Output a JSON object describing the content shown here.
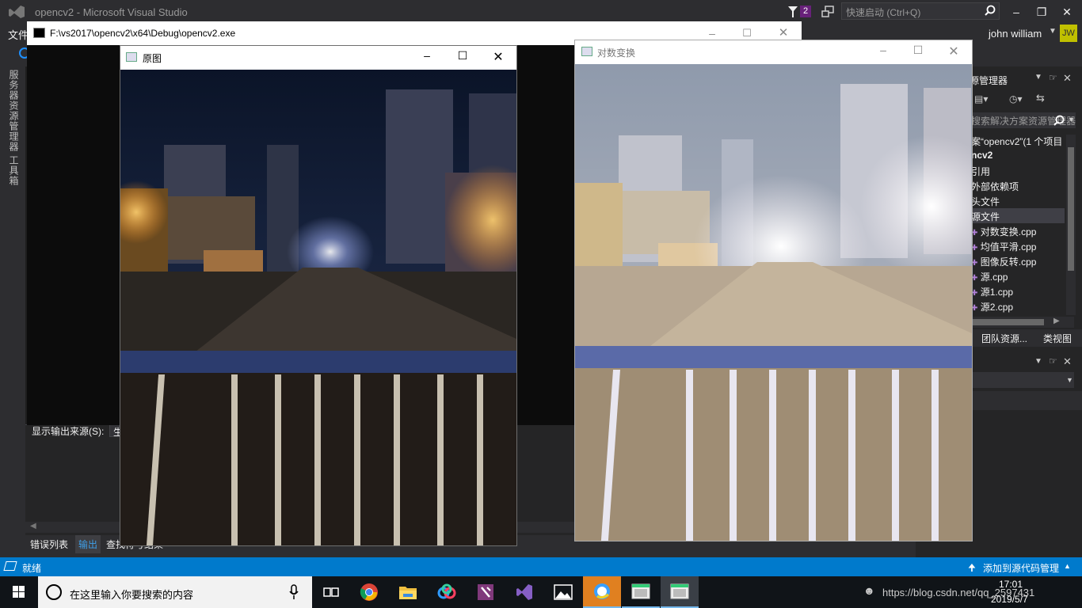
{
  "vs": {
    "title": "opencv2 - Microsoft Visual Studio",
    "notification_count": "2",
    "quick_launch_placeholder": "快速启动 (Ctrl+Q)",
    "menu_first": "文件",
    "user_name": "john william",
    "user_initials": "JW",
    "left_strip": [
      "服务器资源管理器",
      "工具箱"
    ],
    "output": {
      "source_label": "显示输出来源(S):",
      "source_value": "生"
    },
    "bottom_tabs": [
      "错误列表",
      "输出",
      "查找符号结果"
    ],
    "solution_explorer": {
      "title": "源管理器",
      "search_placeholder": "搜索解决方案资源管理器(Ctrl+",
      "items": [
        "案“opencv2”(1 个项目",
        "ncv2",
        "引用",
        "外部依赖项",
        "头文件",
        "源文件"
      ],
      "files": [
        "对数变换.cpp",
        "均值平滑.cpp",
        "图像反转.cpp",
        "源.cpp",
        "源1.cpp",
        "源2.cpp"
      ],
      "tabs": [
        "团队资源...",
        "类视图"
      ]
    },
    "status": {
      "ready": "就绪",
      "source_control": "添加到源代码管理"
    }
  },
  "console": {
    "title": "F:\\vs2017\\opencv2\\x64\\Debug\\opencv2.exe"
  },
  "windows": {
    "original_title": "原图",
    "log_title": "对数变换"
  },
  "taskbar": {
    "search_placeholder": "在这里输入你要搜索的内容",
    "tray_text": "https://blog.csdn.net/qq_2597431",
    "time": "17:01",
    "date": "2019/5/7",
    "apps": [
      "task-view-icon",
      "chrome-icon",
      "file-explorer-icon",
      "baidu-netdisk-icon",
      "onenote-icon",
      "visual-studio-icon",
      "photos-icon",
      "qq-browser-icon",
      "opencv-window-icon",
      "opencv-window-icon"
    ]
  },
  "colors": {
    "vs_bg": "#2d2d30",
    "status_blue": "#007acc",
    "taskbar": "#101418"
  }
}
